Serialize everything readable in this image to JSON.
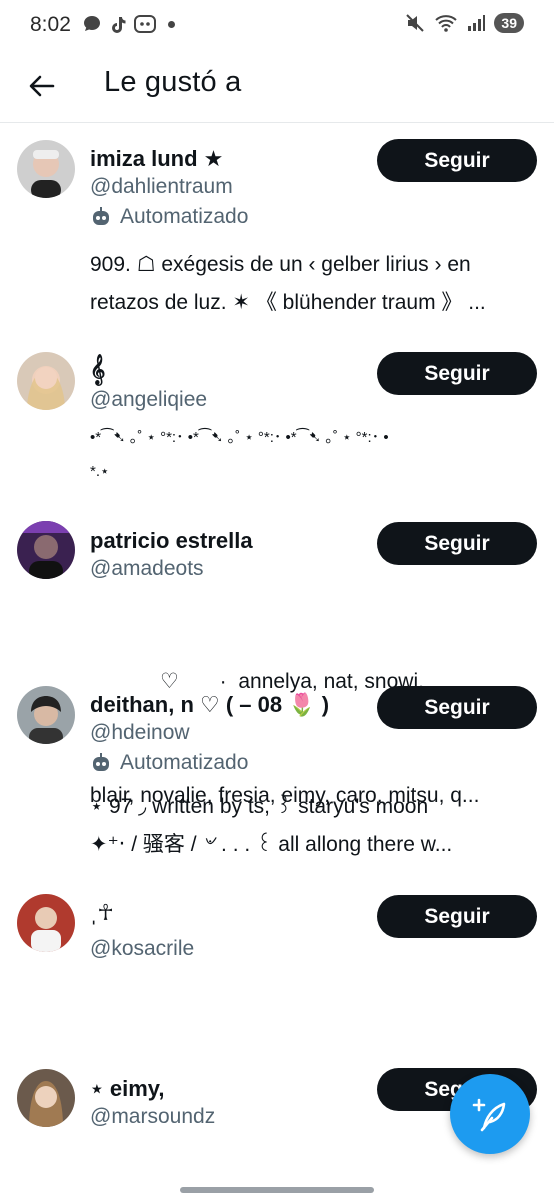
{
  "status_bar": {
    "time": "8:02",
    "battery": "39",
    "icons_left": [
      "chat-bubble-icon",
      "tiktok-icon",
      "discord-icon",
      "dot-icon"
    ],
    "icons_right": [
      "mute-icon",
      "wifi-icon",
      "signal-icon"
    ]
  },
  "header": {
    "title": "Le gustó a",
    "back_icon": "arrow-left-icon"
  },
  "follow_label": "Seguir",
  "automated_label": "Automatizado",
  "users": [
    {
      "name": "imiza lund ★",
      "handle": "@dahlientraum",
      "automated": true,
      "bio": [
        "909. ☖ exégesis de un ‹ gelber lirius › en",
        "retazos de luz. ✶ 《 blühender traum 》 ..."
      ]
    },
    {
      "name": "𝄞",
      "handle": "@angeliqiee",
      "automated": false,
      "bio": [
        "•*⁀➷ ｡˚ ⋆  °*:･  •*⁀➷ ｡˚ ⋆  °*:･  •*⁀➷ ｡˚ ⋆  °*:･ •",
        "*.⋆"
      ]
    },
    {
      "name": "patricio estrella",
      "handle": "@amadeots",
      "automated": false,
      "bio": [
        "            ♡       ·  annelya, nat, snowi,",
        "blair, novalie, fresia, eimy, caro, mitsu, q..."
      ]
    },
    {
      "name": "deithan, n ♡ ( – 08 🌷 )",
      "handle": "@hdeinow",
      "automated": true,
      "bio": [
        "⋆  97   ◞  written by ts, ꒱  staryu's moon",
        "✦⁺‧  / 骚客 / ৺  . . .  ꒰  all allong there w..."
      ]
    },
    {
      "name": "ˌ☥",
      "handle": "@kosacrile",
      "automated": false,
      "bio": []
    },
    {
      "name": "⋆ eimy,",
      "handle": "@marsoundz",
      "automated": false,
      "bio": []
    }
  ],
  "colors": {
    "text": "#0f1419",
    "secondary": "#536471",
    "button": "#0f1419",
    "fab": "#1d9bf0"
  },
  "fab_icon": "compose-feather-plus-icon"
}
